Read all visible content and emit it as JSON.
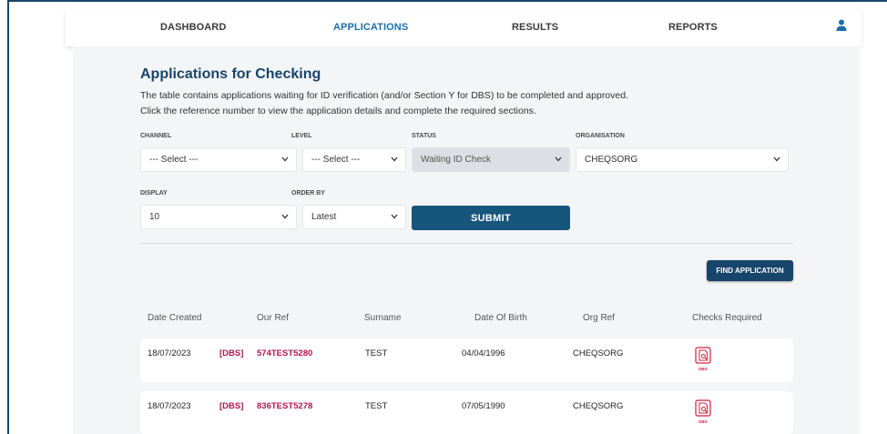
{
  "nav": {
    "items": [
      {
        "label": "DASHBOARD",
        "active": false
      },
      {
        "label": "APPLICATIONS",
        "active": true
      },
      {
        "label": "RESULTS",
        "active": false
      },
      {
        "label": "REPORTS",
        "active": false
      }
    ],
    "user_icon": "user-icon"
  },
  "page": {
    "title": "Applications for Checking",
    "description_1": "The table contains applications waiting for ID verification (and/or Section Y for DBS) to be completed and approved.",
    "description_2": "Click the reference number to view the application details and complete the required sections."
  },
  "filters": {
    "channel": {
      "label": "CHANNEL",
      "value": "--- Select ---"
    },
    "level": {
      "label": "LEVEL",
      "value": "--- Select ---"
    },
    "status": {
      "label": "STATUS",
      "value": "Waiting ID Check"
    },
    "organisation": {
      "label": "ORGANISATION",
      "value": "CHEQSORG"
    },
    "display": {
      "label": "DISPLAY",
      "value": "10"
    },
    "order_by": {
      "label": "ORDER BY",
      "value": "Latest"
    },
    "submit_label": "SUBMIT"
  },
  "find_application_label": "FIND APPLICATION",
  "table": {
    "headers": [
      "Date Created",
      "Our Ref",
      "Surname",
      "Date Of Birth",
      "Org Ref",
      "Checks Required"
    ],
    "rows": [
      {
        "date_created": "18/07/2023",
        "tag": "[DBS]",
        "ref": "574TEST5280",
        "surname": "TEST",
        "dob": "04/04/1996",
        "org_ref": "CHEQSORG",
        "check_label": "DBS"
      },
      {
        "date_created": "18/07/2023",
        "tag": "[DBS]",
        "ref": "836TEST5278",
        "surname": "TEST",
        "dob": "07/05/1990",
        "org_ref": "CHEQSORG",
        "check_label": "DBS"
      }
    ]
  },
  "colors": {
    "brand_navy": "#17456b",
    "active_nav": "#1d6fa8",
    "ref_link": "#b0174f",
    "check_icon": "#d01f3c"
  }
}
